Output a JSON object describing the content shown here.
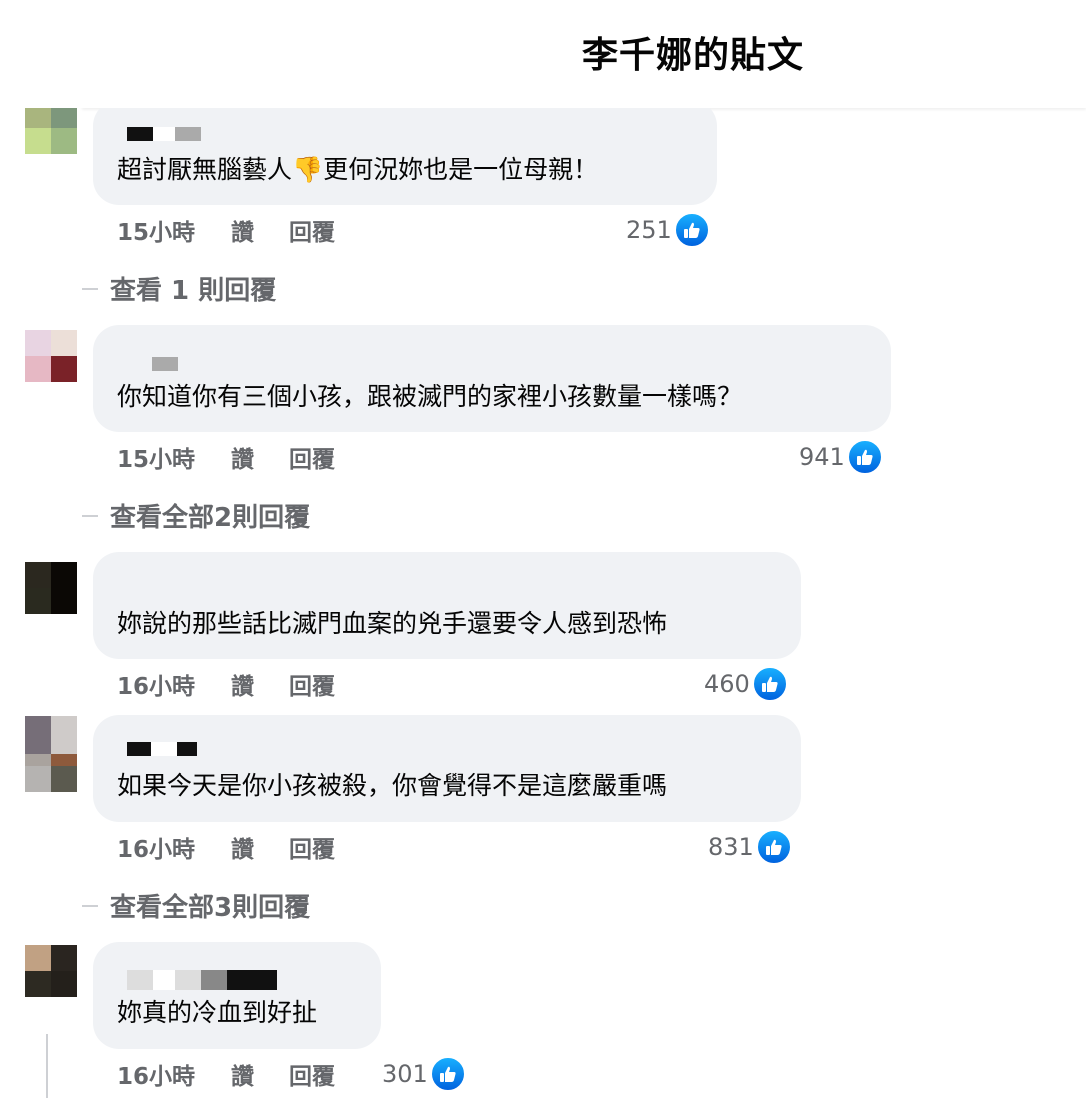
{
  "header": {
    "title": "李千娜的貼文"
  },
  "comments": [
    {
      "text": "超討厭無腦藝人👎更何況妳也是一位母親！",
      "time": "15小時",
      "like": "讚",
      "reply": "回覆",
      "reactions": "251",
      "view_replies": "查看 1 則回覆"
    },
    {
      "text": "你知道你有三個小孩，跟被滅門的家裡小孩數量一樣嗎？",
      "time": "15小時",
      "like": "讚",
      "reply": "回覆",
      "reactions": "941",
      "view_replies": "查看全部2則回覆"
    },
    {
      "text": "妳說的那些話比滅門血案的兇手還要令人感到恐怖",
      "time": "16小時",
      "like": "讚",
      "reply": "回覆",
      "reactions": "460"
    },
    {
      "text": "如果今天是你小孩被殺，你會覺得不是這麼嚴重嗎",
      "time": "16小時",
      "like": "讚",
      "reply": "回覆",
      "reactions": "831",
      "view_replies": "查看全部3則回覆"
    },
    {
      "text": "妳真的冷血到好扯",
      "time": "16小時",
      "like": "讚",
      "reply": "回覆",
      "reactions": "301"
    }
  ],
  "colors": {
    "like_blue": "#0866ff",
    "meta_gray": "#65676b",
    "bubble_bg": "#f0f2f5"
  },
  "icons": {
    "reaction": "thumbs-up-icon",
    "avatar": "pixelated-avatar"
  }
}
